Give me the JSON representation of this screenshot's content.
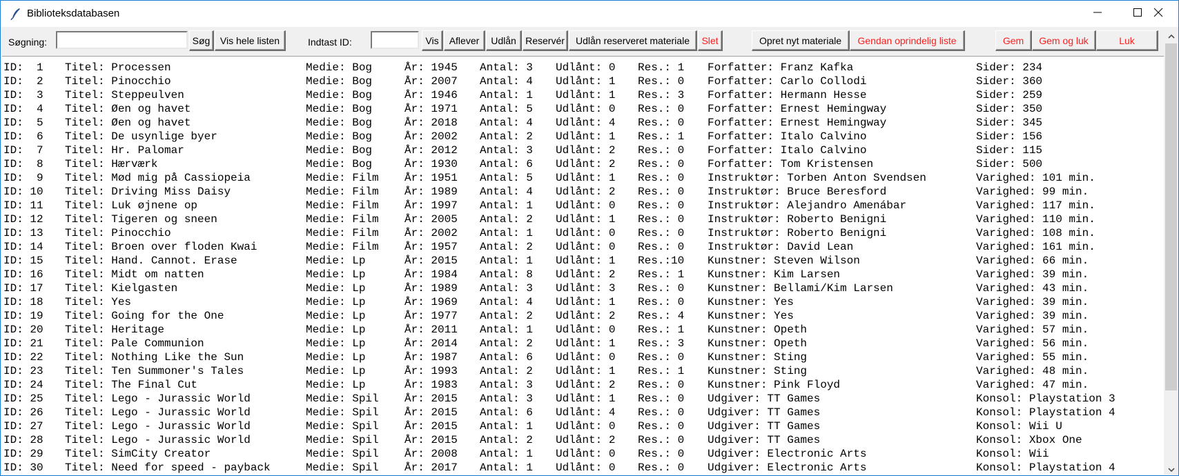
{
  "window": {
    "title": "Biblioteksdatabasen",
    "controls": [
      "minimize",
      "maximize",
      "close"
    ]
  },
  "toolbar": {
    "search_label": "Søgning:",
    "search_value": "",
    "search_button": "Søg",
    "show_all_button": "Vis hele listen",
    "id_label": "Indtast ID:",
    "id_value": "",
    "show_button": "Vis",
    "return_button": "Aflever",
    "lend_button": "Udlån",
    "reserve_button": "Reservér",
    "lend_reserved_button": "Udlån reserveret materiale",
    "delete_button": "Slet",
    "create_button": "Opret nyt materiale",
    "restore_button": "Gendan oprindelig liste",
    "save_button": "Gem",
    "save_close_button": "Gem og luk",
    "close_button": "Luk"
  },
  "colors": {
    "danger_text": "#ff2020",
    "window_border": "#1a7fd4"
  },
  "scrollbar": {
    "visible_fraction": 0.83,
    "position": 0.0
  },
  "rows": [
    {
      "id": "ID:  1",
      "titel": "Titel: Processen",
      "medie": "Medie: Bog",
      "aar": "År: 1945",
      "antal": "Antal: 3",
      "udlaant": "Udlånt: 0",
      "res": "Res.: 1",
      "creator": "Forfatter: Franz Kafka",
      "extra": "Sider: 234"
    },
    {
      "id": "ID:  2",
      "titel": "Titel: Pinocchio",
      "medie": "Medie: Bog",
      "aar": "År: 2007",
      "antal": "Antal: 4",
      "udlaant": "Udlånt: 1",
      "res": "Res.: 0",
      "creator": "Forfatter: Carlo Collodi",
      "extra": "Sider: 360"
    },
    {
      "id": "ID:  3",
      "titel": "Titel: Steppeulven",
      "medie": "Medie: Bog",
      "aar": "År: 1946",
      "antal": "Antal: 1",
      "udlaant": "Udlånt: 1",
      "res": "Res.: 3",
      "creator": "Forfatter: Hermann Hesse",
      "extra": "Sider: 259"
    },
    {
      "id": "ID:  4",
      "titel": "Titel: Øen og havet",
      "medie": "Medie: Bog",
      "aar": "År: 1971",
      "antal": "Antal: 5",
      "udlaant": "Udlånt: 0",
      "res": "Res.: 0",
      "creator": "Forfatter: Ernest Hemingway",
      "extra": "Sider: 350"
    },
    {
      "id": "ID:  5",
      "titel": "Titel: Øen og havet",
      "medie": "Medie: Bog",
      "aar": "År: 2018",
      "antal": "Antal: 4",
      "udlaant": "Udlånt: 4",
      "res": "Res.: 0",
      "creator": "Forfatter: Ernest Hemingway",
      "extra": "Sider: 345"
    },
    {
      "id": "ID:  6",
      "titel": "Titel: De usynlige byer",
      "medie": "Medie: Bog",
      "aar": "År: 2002",
      "antal": "Antal: 2",
      "udlaant": "Udlånt: 1",
      "res": "Res.: 1",
      "creator": "Forfatter: Italo Calvino",
      "extra": "Sider: 156"
    },
    {
      "id": "ID:  7",
      "titel": "Titel: Hr. Palomar",
      "medie": "Medie: Bog",
      "aar": "År: 2012",
      "antal": "Antal: 3",
      "udlaant": "Udlånt: 2",
      "res": "Res.: 0",
      "creator": "Forfatter: Italo Calvino",
      "extra": "Sider: 115"
    },
    {
      "id": "ID:  8",
      "titel": "Titel: Hærværk",
      "medie": "Medie: Bog",
      "aar": "År: 1930",
      "antal": "Antal: 6",
      "udlaant": "Udlånt: 2",
      "res": "Res.: 0",
      "creator": "Forfatter: Tom Kristensen",
      "extra": "Sider: 500"
    },
    {
      "id": "ID:  9",
      "titel": "Titel: Mød mig på Cassiopeia",
      "medie": "Medie: Film",
      "aar": "År: 1951",
      "antal": "Antal: 5",
      "udlaant": "Udlånt: 1",
      "res": "Res.: 0",
      "creator": "Instruktør: Torben Anton Svendsen",
      "extra": "Varighed: 101 min."
    },
    {
      "id": "ID: 10",
      "titel": "Titel: Driving Miss Daisy",
      "medie": "Medie: Film",
      "aar": "År: 1989",
      "antal": "Antal: 4",
      "udlaant": "Udlånt: 2",
      "res": "Res.: 0",
      "creator": "Instruktør: Bruce Beresford",
      "extra": "Varighed: 99 min."
    },
    {
      "id": "ID: 11",
      "titel": "Titel: Luk øjnene op",
      "medie": "Medie: Film",
      "aar": "År: 1997",
      "antal": "Antal: 1",
      "udlaant": "Udlånt: 0",
      "res": "Res.: 0",
      "creator": "Instruktør: Alejandro Amenábar",
      "extra": "Varighed: 117 min."
    },
    {
      "id": "ID: 12",
      "titel": "Titel: Tigeren og sneen",
      "medie": "Medie: Film",
      "aar": "År: 2005",
      "antal": "Antal: 2",
      "udlaant": "Udlånt: 1",
      "res": "Res.: 0",
      "creator": "Instruktør: Roberto Benigni",
      "extra": "Varighed: 110 min."
    },
    {
      "id": "ID: 13",
      "titel": "Titel: Pinocchio",
      "medie": "Medie: Film",
      "aar": "År: 2002",
      "antal": "Antal: 1",
      "udlaant": "Udlånt: 0",
      "res": "Res.: 0",
      "creator": "Instruktør: Roberto Benigni",
      "extra": "Varighed: 108 min."
    },
    {
      "id": "ID: 14",
      "titel": "Titel: Broen over floden Kwai",
      "medie": "Medie: Film",
      "aar": "År: 1957",
      "antal": "Antal: 2",
      "udlaant": "Udlånt: 0",
      "res": "Res.: 0",
      "creator": "Instruktør: David Lean",
      "extra": "Varighed: 161 min."
    },
    {
      "id": "ID: 15",
      "titel": "Titel: Hand. Cannot. Erase",
      "medie": "Medie: Lp",
      "aar": "År: 2015",
      "antal": "Antal: 1",
      "udlaant": "Udlånt: 1",
      "res": "Res.:10",
      "creator": "Kunstner: Steven Wilson",
      "extra": "Varighed: 66 min."
    },
    {
      "id": "ID: 16",
      "titel": "Titel: Midt om natten",
      "medie": "Medie: Lp",
      "aar": "År: 1984",
      "antal": "Antal: 8",
      "udlaant": "Udlånt: 2",
      "res": "Res.: 1",
      "creator": "Kunstner: Kim Larsen",
      "extra": "Varighed: 39 min."
    },
    {
      "id": "ID: 17",
      "titel": "Titel: Kielgasten",
      "medie": "Medie: Lp",
      "aar": "År: 1989",
      "antal": "Antal: 3",
      "udlaant": "Udlånt: 3",
      "res": "Res.: 0",
      "creator": "Kunstner: Bellami/Kim Larsen",
      "extra": "Varighed: 43 min."
    },
    {
      "id": "ID: 18",
      "titel": "Titel: Yes",
      "medie": "Medie: Lp",
      "aar": "År: 1969",
      "antal": "Antal: 4",
      "udlaant": "Udlånt: 1",
      "res": "Res.: 0",
      "creator": "Kunstner: Yes",
      "extra": "Varighed: 39 min."
    },
    {
      "id": "ID: 19",
      "titel": "Titel: Going for the One",
      "medie": "Medie: Lp",
      "aar": "År: 1977",
      "antal": "Antal: 2",
      "udlaant": "Udlånt: 2",
      "res": "Res.: 4",
      "creator": "Kunstner: Yes",
      "extra": "Varighed: 39 min."
    },
    {
      "id": "ID: 20",
      "titel": "Titel: Heritage",
      "medie": "Medie: Lp",
      "aar": "År: 2011",
      "antal": "Antal: 1",
      "udlaant": "Udlånt: 0",
      "res": "Res.: 1",
      "creator": "Kunstner: Opeth",
      "extra": "Varighed: 57 min."
    },
    {
      "id": "ID: 21",
      "titel": "Titel: Pale Communion",
      "medie": "Medie: Lp",
      "aar": "År: 2014",
      "antal": "Antal: 2",
      "udlaant": "Udlånt: 1",
      "res": "Res.: 3",
      "creator": "Kunstner: Opeth",
      "extra": "Varighed: 56 min."
    },
    {
      "id": "ID: 22",
      "titel": "Titel: Nothing Like the Sun",
      "medie": "Medie: Lp",
      "aar": "År: 1987",
      "antal": "Antal: 6",
      "udlaant": "Udlånt: 0",
      "res": "Res.: 0",
      "creator": "Kunstner: Sting",
      "extra": "Varighed: 55 min."
    },
    {
      "id": "ID: 23",
      "titel": "Titel: Ten Summoner's Tales",
      "medie": "Medie: Lp",
      "aar": "År: 1993",
      "antal": "Antal: 2",
      "udlaant": "Udlånt: 1",
      "res": "Res.: 1",
      "creator": "Kunstner: Sting",
      "extra": "Varighed: 48 min."
    },
    {
      "id": "ID: 24",
      "titel": "Titel: The Final Cut",
      "medie": "Medie: Lp",
      "aar": "År: 1983",
      "antal": "Antal: 3",
      "udlaant": "Udlånt: 2",
      "res": "Res.: 0",
      "creator": "Kunstner: Pink Floyd",
      "extra": "Varighed: 47 min."
    },
    {
      "id": "ID: 25",
      "titel": "Titel: Lego - Jurassic World",
      "medie": "Medie: Spil",
      "aar": "År: 2015",
      "antal": "Antal: 3",
      "udlaant": "Udlånt: 1",
      "res": "Res.: 0",
      "creator": "Udgiver: TT Games",
      "extra": "Konsol: Playstation 3"
    },
    {
      "id": "ID: 26",
      "titel": "Titel: Lego - Jurassic World",
      "medie": "Medie: Spil",
      "aar": "År: 2015",
      "antal": "Antal: 6",
      "udlaant": "Udlånt: 4",
      "res": "Res.: 0",
      "creator": "Udgiver: TT Games",
      "extra": "Konsol: Playstation 4"
    },
    {
      "id": "ID: 27",
      "titel": "Titel: Lego - Jurassic World",
      "medie": "Medie: Spil",
      "aar": "År: 2015",
      "antal": "Antal: 1",
      "udlaant": "Udlånt: 0",
      "res": "Res.: 0",
      "creator": "Udgiver: TT Games",
      "extra": "Konsol: Wii U"
    },
    {
      "id": "ID: 28",
      "titel": "Titel: Lego - Jurassic World",
      "medie": "Medie: Spil",
      "aar": "År: 2015",
      "antal": "Antal: 2",
      "udlaant": "Udlånt: 2",
      "res": "Res.: 0",
      "creator": "Udgiver: TT Games",
      "extra": "Konsol: Xbox One"
    },
    {
      "id": "ID: 29",
      "titel": "Titel: SimCity Creator",
      "medie": "Medie: Spil",
      "aar": "År: 2008",
      "antal": "Antal: 1",
      "udlaant": "Udlånt: 0",
      "res": "Res.: 0",
      "creator": "Udgiver: Electronic Arts",
      "extra": "Konsol: Wii"
    },
    {
      "id": "ID: 30",
      "titel": "Titel: Need for speed - payback",
      "medie": "Medie: Spil",
      "aar": "År: 2017",
      "antal": "Antal: 1",
      "udlaant": "Udlånt: 0",
      "res": "Res.: 0",
      "creator": "Udgiver: Electronic Arts",
      "extra": "Konsol: Playstation 4"
    }
  ]
}
